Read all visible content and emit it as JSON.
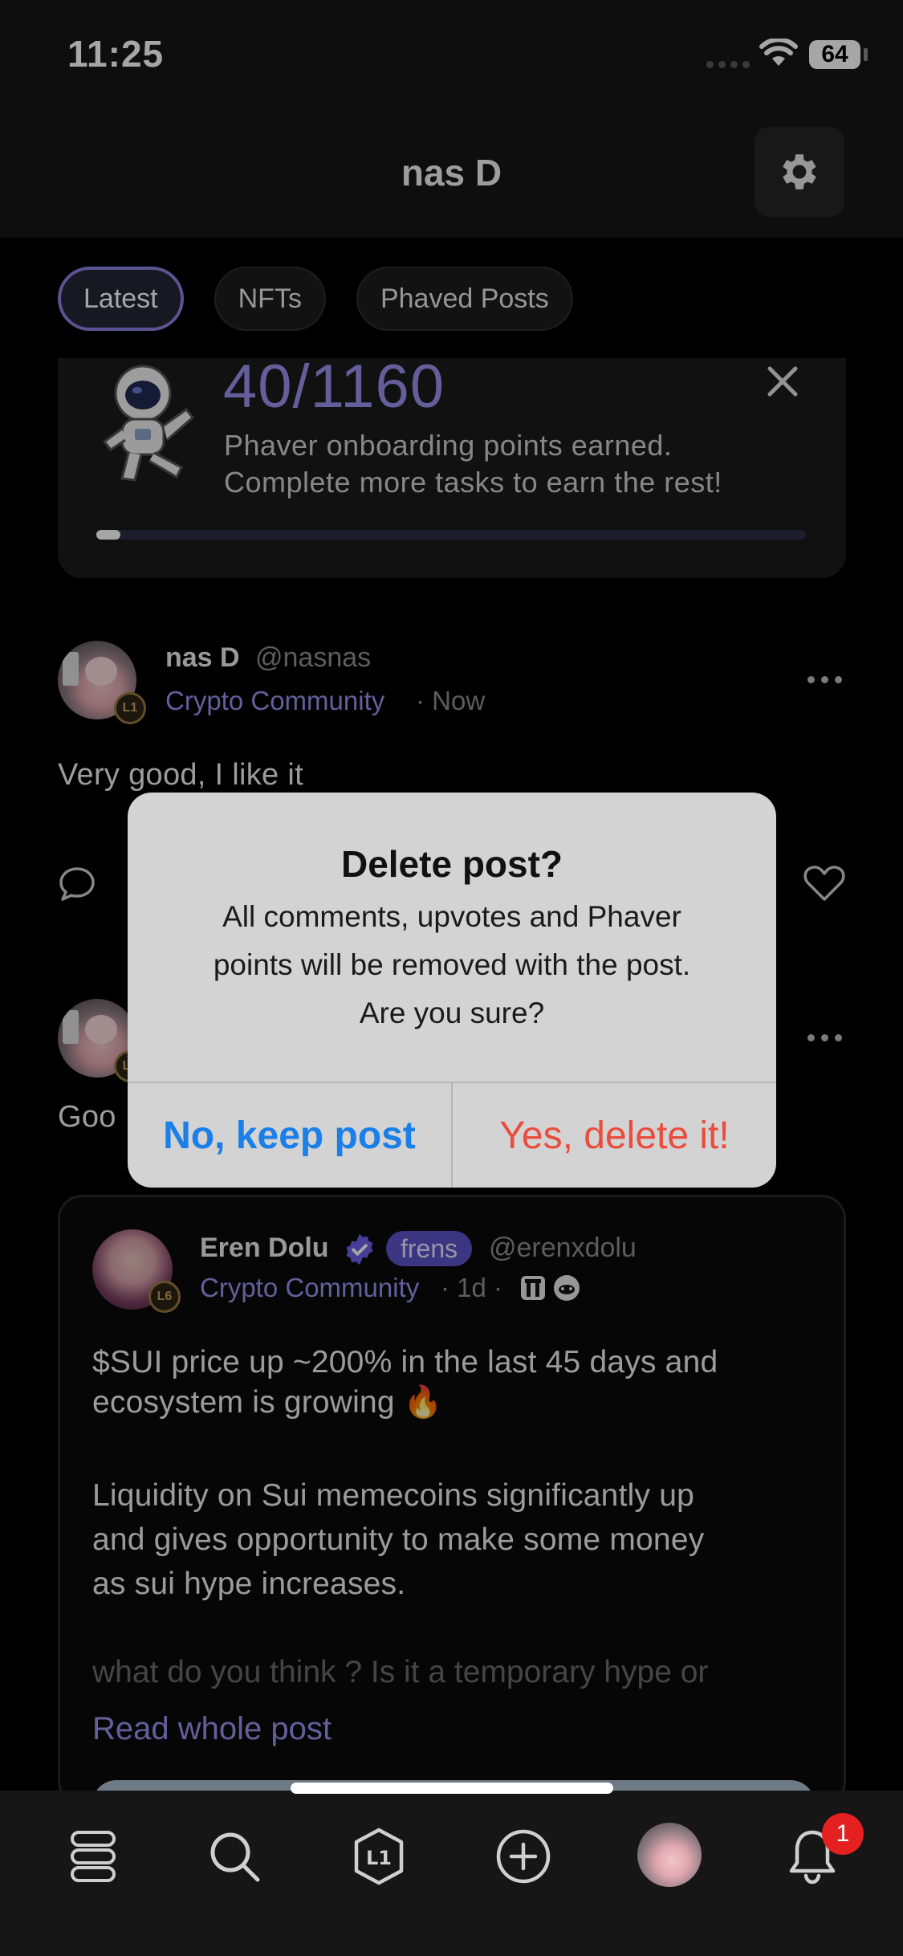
{
  "status_bar": {
    "time": "11:25",
    "battery": "64"
  },
  "header": {
    "title": "nas D"
  },
  "tabs": [
    {
      "label": "Latest",
      "active": true
    },
    {
      "label": "NFTs",
      "active": false
    },
    {
      "label": "Phaved Posts",
      "active": false
    }
  ],
  "onboarding": {
    "points": "40/1160",
    "line1": "Phaver onboarding points earned.",
    "line2": "Complete more tasks to earn the rest!",
    "progress_fraction": 0.034
  },
  "post1": {
    "name": "nas D",
    "handle": "@nasnas",
    "community": "Crypto Community",
    "time": "· Now",
    "level": "L1",
    "text": "Very good, I like it"
  },
  "post2": {
    "level": "L1",
    "text_visible": "Goo"
  },
  "dialog": {
    "title": "Delete post?",
    "body_line1": "All comments, upvotes and Phaver",
    "body_line2": "points will be removed with the post.",
    "body_line3": "Are you sure?",
    "keep_label": "No, keep post",
    "delete_label": "Yes, delete it!"
  },
  "quoted_post": {
    "name": "Eren Dolu",
    "badge": "frens",
    "handle": "@erenxdolu",
    "community": "Crypto Community",
    "time": "· 1d ·",
    "level": "L6",
    "para1_line1": "$SUI price up ~200% in the last 45 days and",
    "para1_line2": "ecosystem is growing 🔥",
    "para2_line1": "Liquidity on Sui memecoins significantly up",
    "para2_line2": "and gives opportunity to make some money",
    "para2_line3": "as sui hype increases.",
    "para3_line1": "what do you think ? Is it a temporary hype or",
    "read_more": "Read whole post"
  },
  "tabbar": {
    "notification_count": "1"
  },
  "colors": {
    "accent": "#9a92ee",
    "delete_red": "#ea4c3d",
    "keep_blue": "#1a7fe8",
    "background": "#000000"
  },
  "icons": [
    "gear-icon",
    "close-icon",
    "comment-icon",
    "heart-icon",
    "verified-icon",
    "feed-icon",
    "search-icon",
    "level-icon",
    "plus-icon",
    "bell-icon",
    "wifi-icon"
  ]
}
